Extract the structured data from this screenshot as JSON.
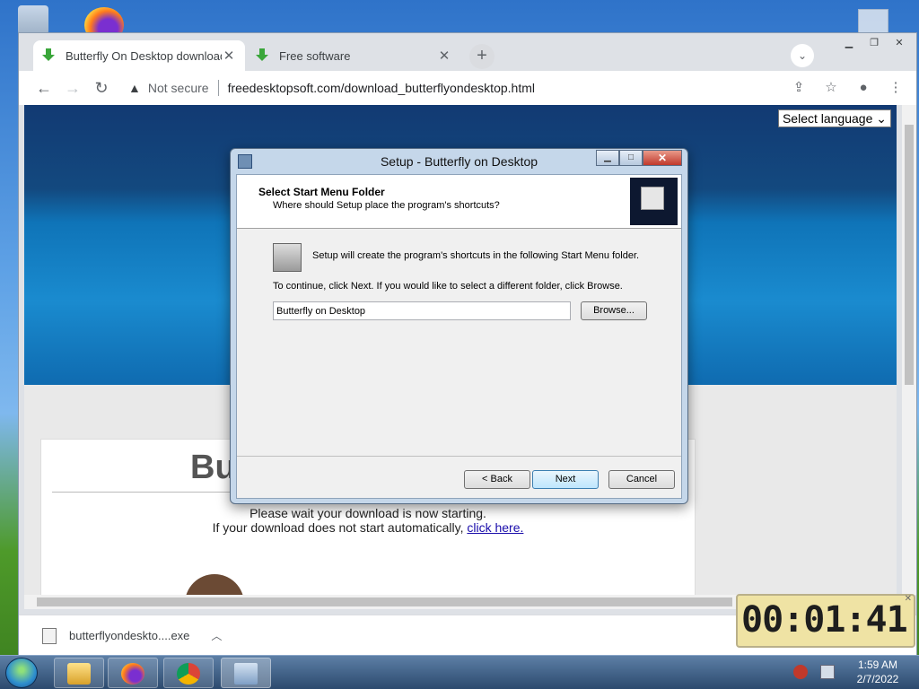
{
  "browser": {
    "tabs": [
      {
        "label": "Butterfly On Desktop download"
      },
      {
        "label": "Free software"
      }
    ],
    "newtab_label": "+",
    "address": {
      "security": "Not secure",
      "url": "freedesktopsoft.com/download_butterflyondesktop.html"
    }
  },
  "page": {
    "language_select": "Select language",
    "big_title": "Bu",
    "wait_line1": "Please wait your download is now starting.",
    "wait_line2": "If your download does not start automatically,",
    "click_here": "click here."
  },
  "downloads": {
    "file_name": "butterflyondeskto....exe"
  },
  "dialog": {
    "title": "Setup - Butterfly on Desktop",
    "header_title": "Select Start Menu Folder",
    "header_subtitle": "Where should Setup place the program's shortcuts?",
    "info_line": "Setup will create the program's shortcuts in the following Start Menu folder.",
    "instructions": "To continue, click Next. If you would like to select a different folder, click Browse.",
    "folder_value": "Butterfly on Desktop",
    "browse_label": "Browse...",
    "back_label": "< Back",
    "next_label": "Next",
    "cancel_label": "Cancel"
  },
  "timer": {
    "value": "00:01:41"
  },
  "taskbar": {
    "time": "1:59 AM",
    "date": "2/7/2022"
  }
}
